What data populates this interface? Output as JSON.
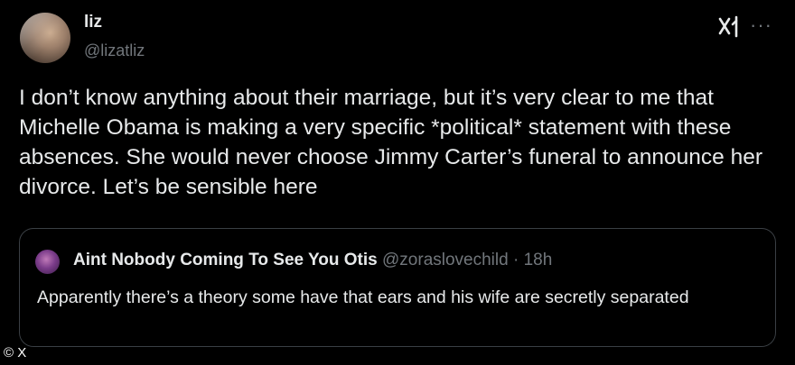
{
  "author": {
    "display_name": "liz",
    "handle": "@lizatliz"
  },
  "header": {
    "grok_icon": "grok-icon",
    "more_icon": "more-icon",
    "more_label": "···"
  },
  "tweet": {
    "text": "I don’t know anything about their marriage, but it’s very clear to me that Michelle Obama is making a very specific *political* statement with these absences. She would never choose Jimmy Carter’s funeral to announce her divorce. Let’s be sensible here"
  },
  "quote": {
    "display_name": "Aint Nobody Coming To See You Otis",
    "handle": "@zoraslovechild",
    "separator": "·",
    "time": "18h",
    "text": "Apparently there’s a theory some have that ears and his wife are secretly separated"
  },
  "credit": "© X",
  "colors": {
    "background": "#000000",
    "text_primary": "#e7e9ea",
    "text_secondary": "#71767b",
    "border": "#3a3f44"
  }
}
